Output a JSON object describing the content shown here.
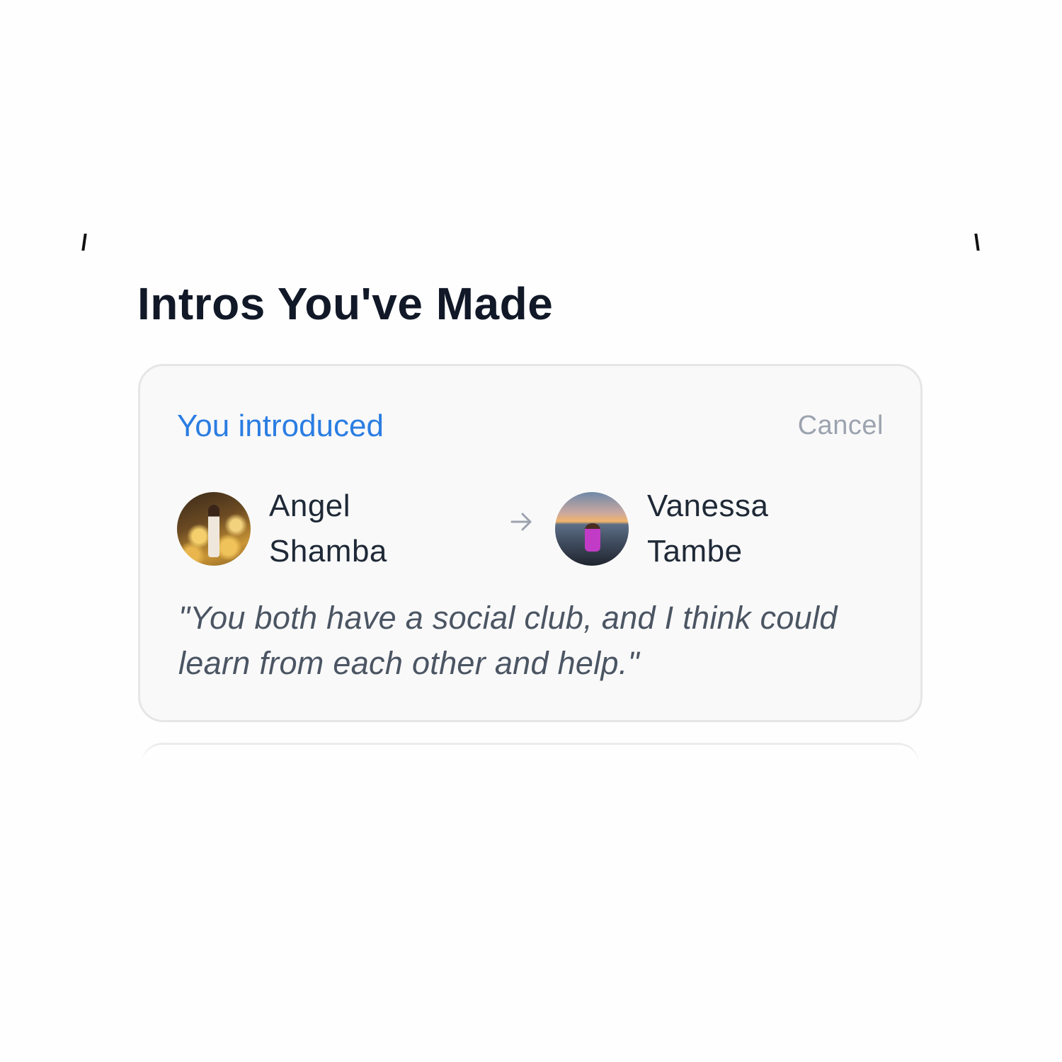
{
  "section": {
    "title": "Intros You've Made"
  },
  "intro_card": {
    "label": "You introduced",
    "cancel_label": "Cancel",
    "from_person": {
      "first_name": "Angel",
      "last_name": "Shamba",
      "avatar_icon": "photo-avatar"
    },
    "arrow_icon": "arrow-right-icon",
    "to_person": {
      "first_name": "Vanessa",
      "last_name": "Tambe",
      "avatar_icon": "photo-avatar"
    },
    "message": "\"You both have a social club, and I think could learn from each other and help.\""
  },
  "colors": {
    "accent": "#2b7de2",
    "title": "#111827",
    "muted": "#9ca3af",
    "quote": "#4b5563",
    "card_background": "#f9f9f9"
  }
}
